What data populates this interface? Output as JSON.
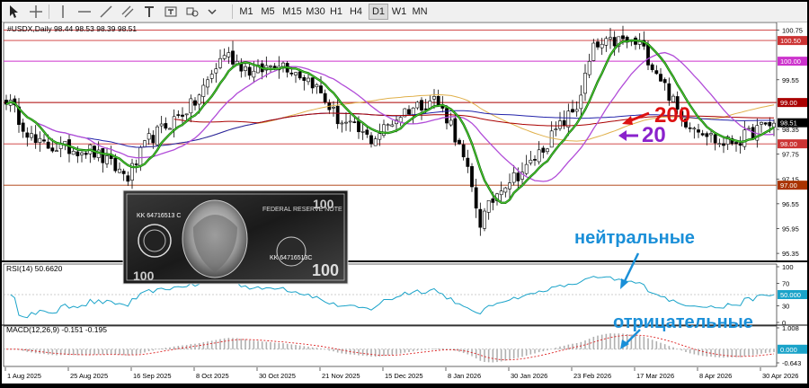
{
  "toolbar": {
    "tools": [
      "cursor-icon",
      "crosshair-icon",
      "hline-icon",
      "trendline-icon",
      "channel-icon",
      "text-icon",
      "label-icon",
      "shapes-icon"
    ],
    "timeframes": [
      "M1",
      "M5",
      "M15",
      "M30",
      "H1",
      "H4",
      "D1",
      "W1",
      "MN"
    ]
  },
  "chart_data": [
    {
      "type": "candlestick",
      "panel": "price",
      "header": "#USDX,Daily  98.44 98.53 98.39 98.51",
      "y_ticks": [
        "100.75",
        "100.50",
        "100.00",
        "99.55",
        "99.00",
        "98.51",
        "98.35",
        "98.00",
        "97.75",
        "97.15",
        "97.00",
        "96.55",
        "95.95",
        "95.35"
      ],
      "levels": [
        {
          "value": 100.75,
          "color": "#cc3333"
        },
        {
          "value": 100.5,
          "color": "#cc3333"
        },
        {
          "value": 100.0,
          "color": "#cc33cc"
        },
        {
          "value": 99.0,
          "color": "#aa0000"
        },
        {
          "value": 98.0,
          "color": "#cc3333"
        },
        {
          "value": 97.0,
          "color": "#aa3300"
        }
      ],
      "last_price": "98.51",
      "annotations": [
        "200",
        "20"
      ],
      "x_labels": [
        "1 Aug 2025",
        "25 Aug 2025",
        "16 Sep 2025",
        "8 Oct 2025",
        "30 Oct 2025",
        "21 Nov 2025",
        "15 Dec 2025",
        "8 Jan 2026",
        "30 Jan 2026",
        "23 Feb 2026",
        "17 Mar 2026",
        "8 Apr 2026",
        "30 Apr 2026"
      ],
      "ylim": [
        95.2,
        100.85
      ],
      "anchors": [
        [
          0,
          99.1
        ],
        [
          7,
          98.0
        ],
        [
          13,
          97.9
        ],
        [
          20,
          97.85
        ],
        [
          29,
          97.2
        ],
        [
          34,
          98.1
        ],
        [
          45,
          99.0
        ],
        [
          52,
          100.2
        ],
        [
          59,
          99.7
        ],
        [
          65,
          100.0
        ],
        [
          73,
          99.5
        ],
        [
          79,
          98.6
        ],
        [
          87,
          98.1
        ],
        [
          95,
          98.8
        ],
        [
          102,
          99.1
        ],
        [
          106,
          98.5
        ],
        [
          110,
          97.3
        ],
        [
          113,
          96.1
        ],
        [
          118,
          97.0
        ],
        [
          124,
          97.4
        ],
        [
          131,
          98.3
        ],
        [
          136,
          98.9
        ],
        [
          140,
          100.3
        ],
        [
          146,
          100.5
        ],
        [
          151,
          100.4
        ],
        [
          156,
          99.6
        ],
        [
          161,
          98.6
        ],
        [
          166,
          98.35
        ],
        [
          170,
          98.0
        ],
        [
          175,
          98.1
        ],
        [
          179,
          98.35
        ],
        [
          183,
          98.5
        ]
      ],
      "series": [
        {
          "name": "",
          "color": "#e0b04a"
        },
        {
          "name": "",
          "color": "#2222aa"
        },
        {
          "name": "",
          "color": "#aa0000"
        },
        {
          "name": "",
          "color": "#b14cd8"
        },
        {
          "name": "",
          "color": "#006600"
        },
        {
          "name": "",
          "color": "#55cc33"
        }
      ]
    },
    {
      "type": "line",
      "panel": "rsi",
      "header": "RSI(14) 50.6620",
      "y_ticks": [
        "100",
        "70",
        "50.000",
        "30",
        "0"
      ],
      "level": 50,
      "ylim": [
        0,
        100
      ],
      "annotation": "нейтральные"
    },
    {
      "type": "bar",
      "panel": "macd",
      "header": "MACD(12,26,9) -0.151 -0.195",
      "y_ticks": [
        "1.008",
        "0.000",
        "-0.643"
      ],
      "ylim": [
        -0.643,
        1.008
      ],
      "annotation": "отрицательные"
    }
  ],
  "banknote": {
    "serial": "KK 64716513 C",
    "serial_short": "KK 64716513C",
    "denomination": "100",
    "bank_label": "FEDERAL RESERVE NOTE"
  }
}
